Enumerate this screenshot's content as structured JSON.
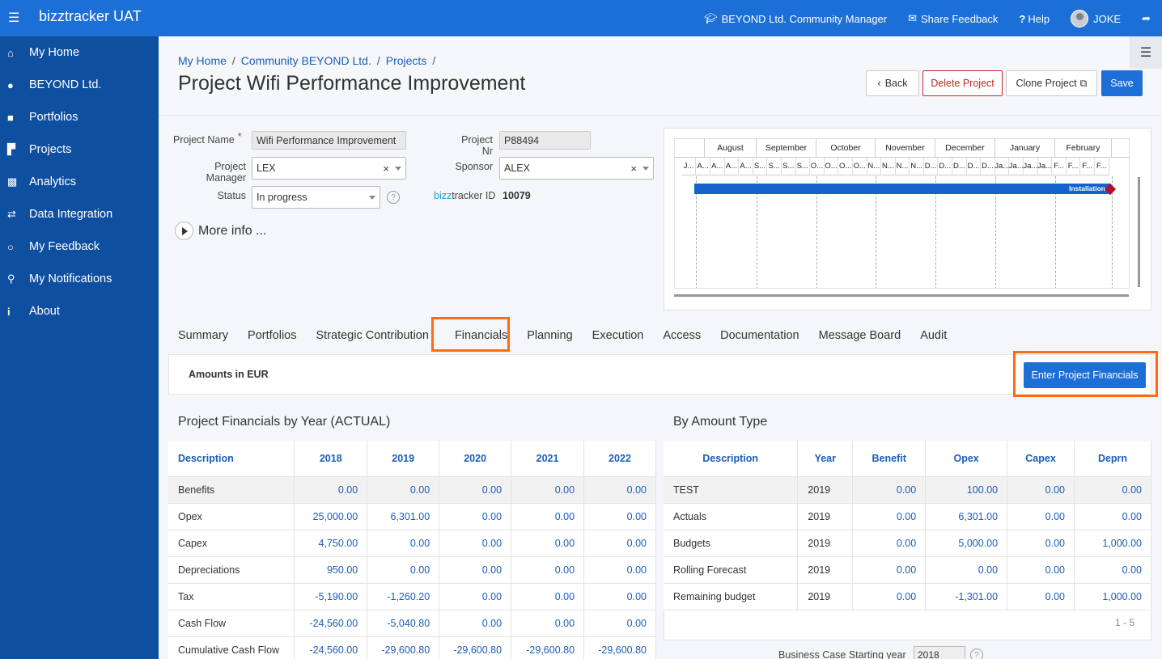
{
  "topbar": {
    "app_title": "bizztracker UAT",
    "role": "BEYOND Ltd. Community Manager",
    "feedback": "Share Feedback",
    "help": "Help",
    "user": "JOKE"
  },
  "sidebar": {
    "items": [
      {
        "label": "My Home",
        "icon": "home-icon"
      },
      {
        "label": "BEYOND Ltd.",
        "icon": "users-icon"
      },
      {
        "label": "Portfolios",
        "icon": "briefcase-icon"
      },
      {
        "label": "Projects",
        "icon": "factory-icon"
      },
      {
        "label": "Analytics",
        "icon": "bar-chart-icon"
      },
      {
        "label": "Data Integration",
        "icon": "exchange-icon"
      },
      {
        "label": "My Feedback",
        "icon": "comments-icon"
      },
      {
        "label": "My Notifications",
        "icon": "bell-icon"
      },
      {
        "label": "About",
        "icon": "info-icon"
      }
    ]
  },
  "breadcrumb": [
    "My Home",
    "Community BEYOND Ltd.",
    "Projects"
  ],
  "page_title": "Project Wifi Performance Improvement",
  "actions": {
    "back": "Back",
    "delete": "Delete Project",
    "clone": "Clone Project",
    "save": "Save"
  },
  "form": {
    "project_name_label": "Project Name",
    "project_name": "Wifi Performance Improvement",
    "project_nr_label": "Project Nr",
    "project_nr": "P88494",
    "manager_label": "Project Manager",
    "manager": "LEX",
    "sponsor_label": "Sponsor",
    "sponsor": "ALEX",
    "status_label": "Status",
    "status": "In progress",
    "bizz_prefix": "bizz",
    "bizz_suffix": "tracker ID",
    "bizz_id": "10079",
    "more_info": "More info ..."
  },
  "gantt": {
    "months": [
      "August",
      "September",
      "October",
      "November",
      "December",
      "January",
      "February"
    ],
    "days": [
      "J...",
      "A...",
      "A...",
      "A...",
      "A...",
      "S...",
      "S...",
      "S...",
      "S...",
      "O...",
      "O...",
      "O...",
      "O...",
      "N...",
      "N...",
      "N...",
      "N...",
      "D...",
      "D...",
      "D...",
      "D...",
      "D...",
      "Ja...",
      "Ja...",
      "Ja...",
      "Ja...",
      "F...",
      "F...",
      "F...",
      "F..."
    ],
    "bar_label": "Installation"
  },
  "tabs": [
    "Summary",
    "Portfolios",
    "Strategic Contribution",
    "Financials",
    "Planning",
    "Execution",
    "Access",
    "Documentation",
    "Message Board",
    "Audit"
  ],
  "amounts_label": "Amounts in EUR",
  "enter_financials": "Enter Project Financials",
  "by_year": {
    "title": "Project Financials by Year (ACTUAL)",
    "headers": [
      "Description",
      "2018",
      "2019",
      "2020",
      "2021",
      "2022"
    ],
    "rows": [
      [
        "Benefits",
        "0.00",
        "0.00",
        "0.00",
        "0.00",
        "0.00"
      ],
      [
        "Opex",
        "25,000.00",
        "6,301.00",
        "0.00",
        "0.00",
        "0.00"
      ],
      [
        "Capex",
        "4,750.00",
        "0.00",
        "0.00",
        "0.00",
        "0.00"
      ],
      [
        "Depreciations",
        "950.00",
        "0.00",
        "0.00",
        "0.00",
        "0.00"
      ],
      [
        "Tax",
        "-5,190.00",
        "-1,260.20",
        "0.00",
        "0.00",
        "0.00"
      ],
      [
        "Cash Flow",
        "-24,560.00",
        "-5,040.80",
        "0.00",
        "0.00",
        "0.00"
      ],
      [
        "Cumulative Cash Flow",
        "-24,560.00",
        "-29,600.80",
        "-29,600.80",
        "-29,600.80",
        "-29,600.80"
      ]
    ]
  },
  "by_type": {
    "title": "By Amount Type",
    "headers": [
      "Description",
      "Year",
      "Benefit",
      "Opex",
      "Capex",
      "Deprn"
    ],
    "rows": [
      [
        "TEST",
        "2019",
        "0.00",
        "100.00",
        "0.00",
        "0.00"
      ],
      [
        "Actuals",
        "2019",
        "0.00",
        "6,301.00",
        "0.00",
        "0.00"
      ],
      [
        "Budgets",
        "2019",
        "0.00",
        "5,000.00",
        "0.00",
        "1,000.00"
      ],
      [
        "Rolling Forecast",
        "2019",
        "0.00",
        "0.00",
        "0.00",
        "0.00"
      ],
      [
        "Remaining budget",
        "2019",
        "0.00",
        "-1,301.00",
        "0.00",
        "1,000.00"
      ]
    ],
    "pager": "1 - 5"
  },
  "business_case": {
    "label": "Business Case Starting year",
    "value": "2018"
  }
}
